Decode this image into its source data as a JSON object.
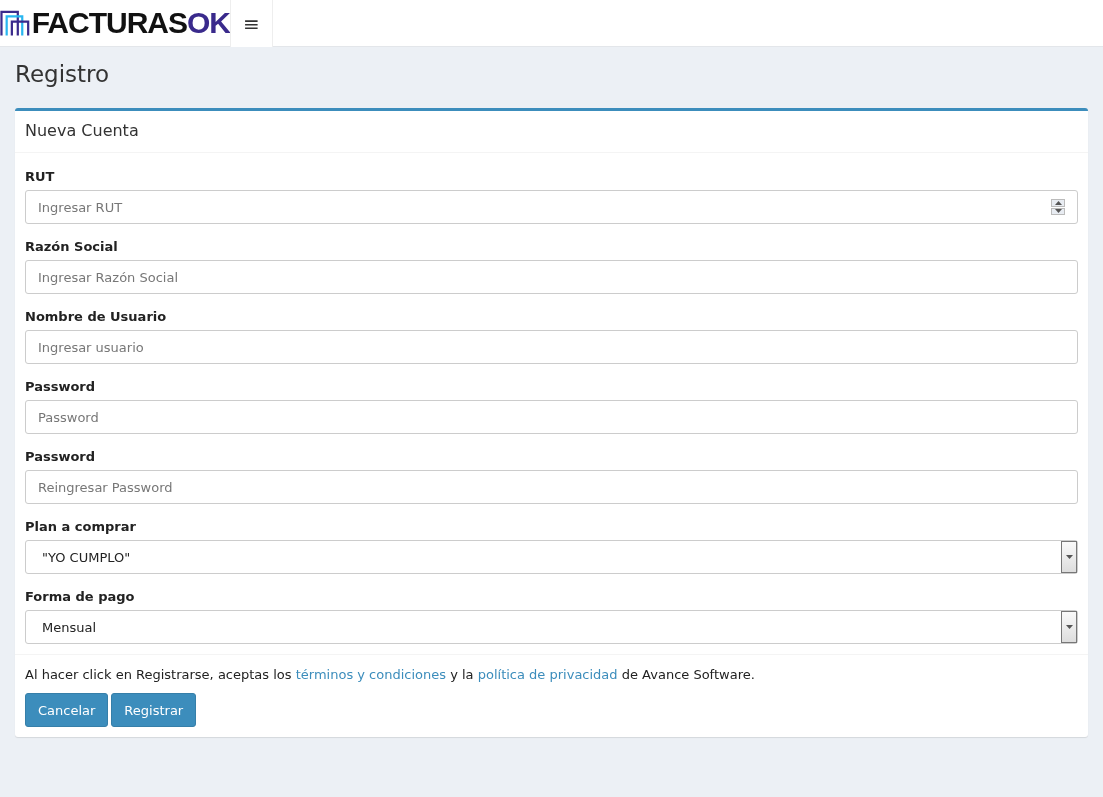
{
  "header": {
    "logo": {
      "text": "FACTURAS",
      "accent": "OK"
    },
    "menu_toggle": "≡"
  },
  "page_title": "Registro",
  "box": {
    "title": "Nueva Cuenta",
    "fields": [
      {
        "label": "RUT",
        "kind": "number",
        "placeholder": "Ingresar RUT"
      },
      {
        "label": "Razón Social",
        "kind": "text",
        "placeholder": "Ingresar Razón Social"
      },
      {
        "label": "Nombre de Usuario",
        "kind": "text",
        "placeholder": "Ingresar usuario"
      },
      {
        "label": "Password",
        "kind": "password",
        "placeholder": "Password"
      },
      {
        "label": "Password",
        "kind": "password",
        "placeholder": "Reingresar Password"
      },
      {
        "label": "Plan a comprar",
        "kind": "select",
        "value": "\"YO CUMPLO\""
      },
      {
        "label": "Forma de pago",
        "kind": "select",
        "value": "Mensual"
      }
    ],
    "terms": [
      {
        "kind": "text",
        "text": "Al hacer click en Registrarse, aceptas los "
      },
      {
        "kind": "link",
        "text": "términos y condiciones"
      },
      {
        "kind": "text",
        "text": " y la "
      },
      {
        "kind": "link",
        "text": "política de privacidad"
      },
      {
        "kind": "text",
        "text": " de Avance Software."
      }
    ],
    "buttons": [
      "Cancelar",
      "Registrar"
    ]
  }
}
